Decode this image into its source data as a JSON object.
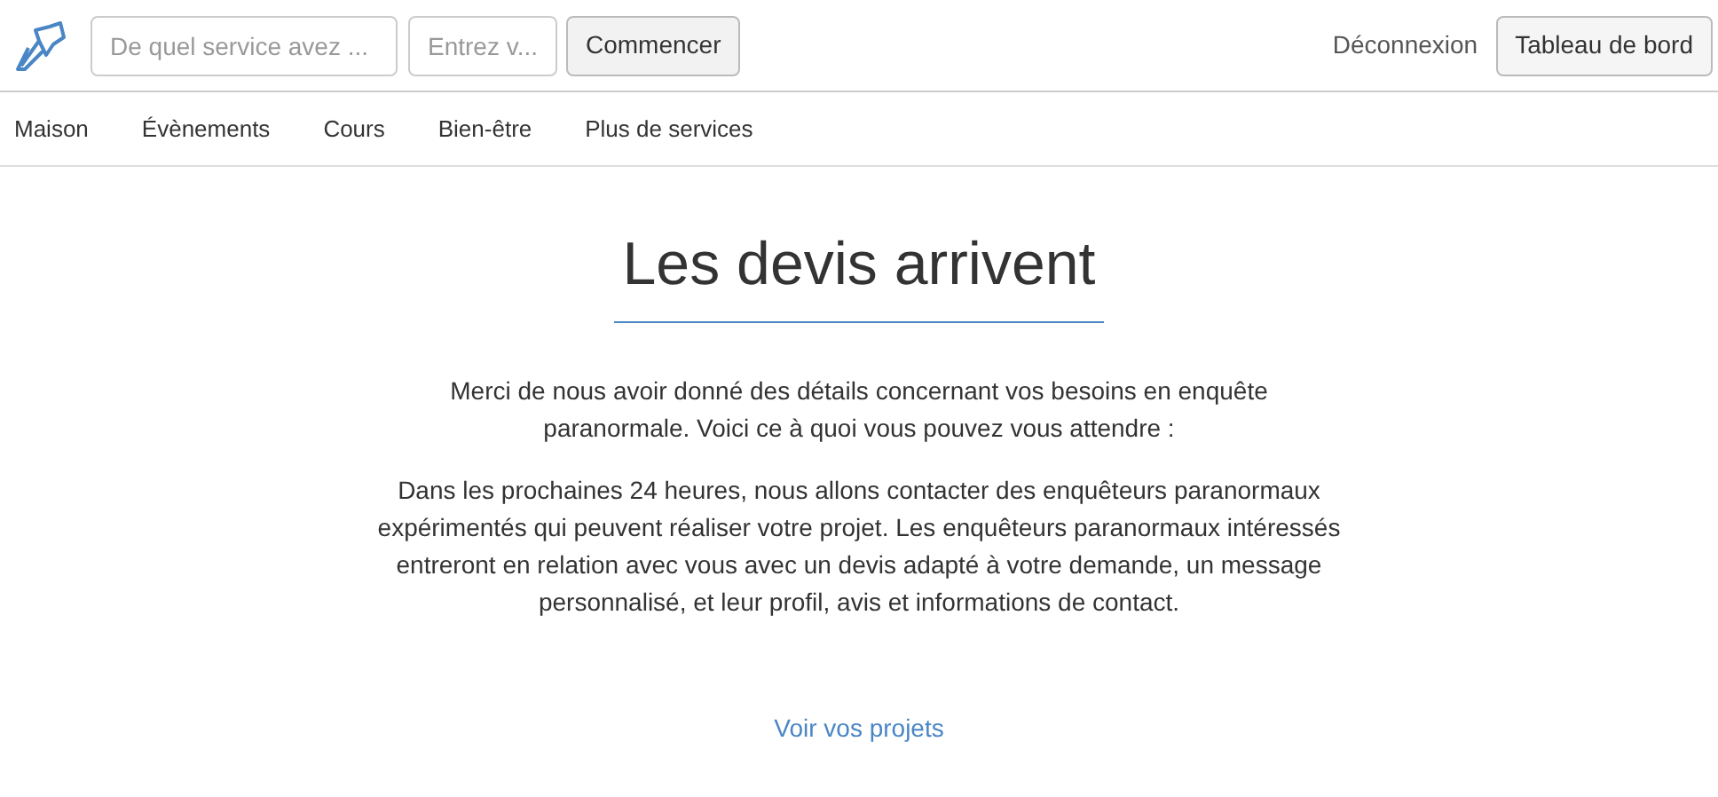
{
  "header": {
    "service_field": {
      "placeholder": "De quel service avez ..."
    },
    "zip_field": {
      "placeholder": "Entrez v..."
    },
    "start_button": "Commencer",
    "logout_link": "Déconnexion",
    "dashboard_button": "Tableau de bord"
  },
  "nav": [
    "Maison",
    "Évènements",
    "Cours",
    "Bien-être",
    "Plus de services"
  ],
  "main": {
    "title": "Les devis arrivent",
    "paragraphs": [
      "Merci de nous avoir donné des détails concernant vos besoins en enquête paranormale. Voici ce à quoi vous pouvez vous attendre :",
      "Dans les prochaines 24 heures, nous allons contacter des enquêteurs paranormaux expérimentés qui peuvent réaliser votre projet. Les enquêteurs paranormaux intéressés entreront en relation avec vous avec un devis adapté à votre demande, un message personnalisé, et leur profil, avis et informations de contact."
    ],
    "projects_link": "Voir vos projets"
  }
}
